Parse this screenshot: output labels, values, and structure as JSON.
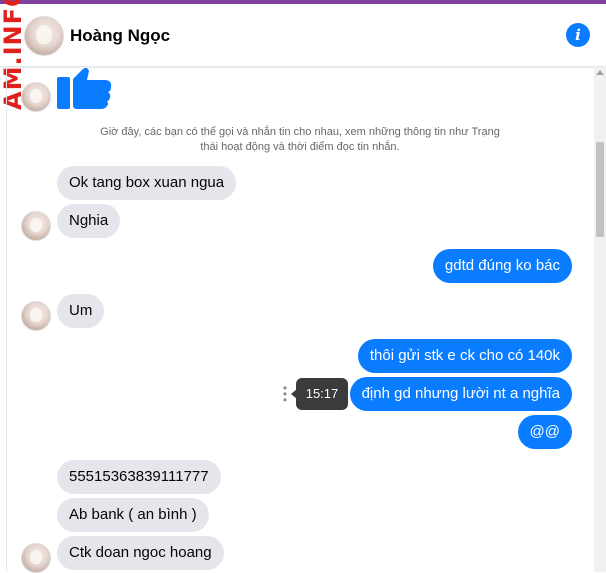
{
  "header": {
    "name": "Hoàng Ngọc",
    "watermark": "AM.INFO"
  },
  "system_note": "Giờ đây, các bạn có thể gọi và nhắn tin cho nhau, xem những thông tin như Trạng thái hoạt động và thời điểm đọc tin nhắn.",
  "messages": [
    {
      "side": "in",
      "text": "Ok tang box xuan ngua"
    },
    {
      "side": "in",
      "text": "Nghia"
    },
    {
      "side": "out",
      "text": "gdtd đúng ko bác"
    },
    {
      "side": "in",
      "text": "Um"
    },
    {
      "side": "out",
      "text": "thôi gửi stk e ck cho có 140k"
    },
    {
      "side": "out",
      "text": "định gd nhưng lười nt a nghĩa"
    },
    {
      "side": "out",
      "text": "@@"
    },
    {
      "side": "in",
      "text": "55515363839111777"
    },
    {
      "side": "in",
      "text": "Ab bank ( an bình )"
    },
    {
      "side": "in",
      "text": "Ctk doan ngoc hoang"
    }
  ],
  "tooltip_time": "15:17",
  "colors": {
    "accent": "#0a7cff",
    "incoming_bubble": "#e4e6eb",
    "watermark": "#e0201b",
    "top_strip": "#7e3fa0"
  },
  "icons": [
    "info-icon",
    "like-icon",
    "more-icon"
  ]
}
